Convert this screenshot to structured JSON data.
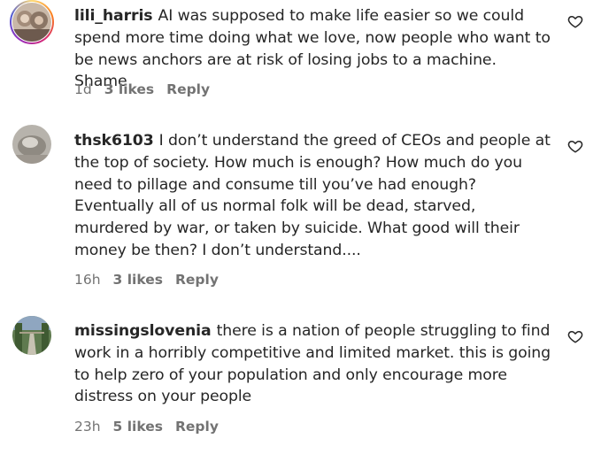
{
  "comments": [
    {
      "username": "lili_harris",
      "text": "AI was supposed to make life easier so we could spend more time doing what we love, now people who want to be news anchors are at risk of losing jobs to a machine. Shame",
      "time": "1d",
      "likes": "3 likes",
      "reply": "Reply"
    },
    {
      "username": "thsk6103",
      "text": "I don’t understand the greed of CEOs and people at the top of society. How much is enough? How much do you need to pillage and consume till you’ve had enough? Eventually all of us normal folk will be dead, starved, murdered by war, or taken by suicide. What good will their money be then? I don’t understand....",
      "time": "16h",
      "likes": "3 likes",
      "reply": "Reply"
    },
    {
      "username": "missingslovenia",
      "text": "there is a nation of people struggling to find work in a horribly competitive and limited market. this is going to help zero of your population and only encourage more distress on your people",
      "time": "23h",
      "likes": "5 likes",
      "reply": "Reply"
    }
  ],
  "colors": {
    "text": "#262626",
    "meta": "#737373"
  }
}
